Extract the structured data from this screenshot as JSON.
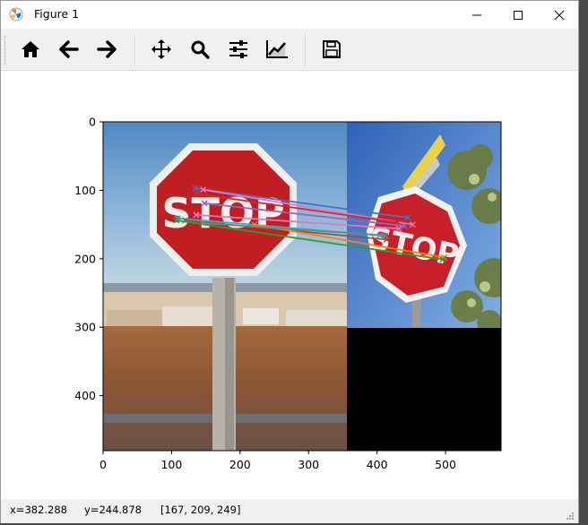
{
  "window": {
    "title": "Figure 1",
    "minimize_icon": "minimize-icon",
    "maximize_icon": "maximize-icon",
    "close_icon": "close-icon"
  },
  "toolbar": {
    "buttons": [
      {
        "name": "home",
        "icon": "home-icon"
      },
      {
        "name": "back",
        "icon": "arrow-left-icon"
      },
      {
        "name": "forward",
        "icon": "arrow-right-icon"
      },
      {
        "name": "pan",
        "icon": "move-arrows-icon"
      },
      {
        "name": "zoom",
        "icon": "magnifier-icon"
      },
      {
        "name": "configure-subplots",
        "icon": "sliders-icon"
      },
      {
        "name": "edit-axis",
        "icon": "line-chart-icon"
      },
      {
        "name": "save",
        "icon": "floppy-disk-icon"
      }
    ]
  },
  "axes": {
    "x_ticks": [
      "0",
      "100",
      "200",
      "300",
      "400",
      "500"
    ],
    "y_ticks": [
      "0",
      "100",
      "200",
      "300",
      "400"
    ]
  },
  "image": {
    "left_image": "stop-sign-photo",
    "right_image": "stop-sign-photo-rotated",
    "left_size": [
      356,
      480
    ],
    "right_size": [
      223,
      300
    ]
  },
  "chart_data": {
    "type": "scatter",
    "xlim": [
      0,
      579
    ],
    "ylim": [
      480,
      0
    ],
    "grid": false,
    "matches": [
      {
        "p1": [
          135,
          97
        ],
        "p2": [
          445,
          140
        ],
        "color": "#4472c4"
      },
      {
        "p1": [
          146,
          99
        ],
        "p2": [
          452,
          150
        ],
        "color": "#e377c2"
      },
      {
        "p1": [
          136,
          105
        ],
        "p2": [
          430,
          147
        ],
        "color": "#d62728"
      },
      {
        "p1": [
          148,
          119
        ],
        "p2": [
          440,
          152
        ],
        "color": "#9467bd"
      },
      {
        "p1": [
          136,
          136
        ],
        "p2": [
          432,
          156
        ],
        "color": "#e377c2"
      },
      {
        "p1": [
          109,
          141
        ],
        "p2": [
          404,
          166
        ],
        "color": "#17becf"
      },
      {
        "p1": [
          120,
          144
        ],
        "p2": [
          414,
          172
        ],
        "color": "#8c564b"
      },
      {
        "p1": [
          221,
          150
        ],
        "p2": [
          498,
          198
        ],
        "color": "#ff7f0e"
      },
      {
        "p1": [
          107,
          144
        ],
        "p2": [
          496,
          201
        ],
        "color": "#2ca02c"
      },
      {
        "p1": [
          146,
          148
        ],
        "p2": [
          412,
          166
        ],
        "color": "#7f7f7f"
      }
    ]
  },
  "status": {
    "x_label": "x=382.288",
    "y_label": "y=244.878",
    "rgb": "[167, 209, 249]"
  }
}
